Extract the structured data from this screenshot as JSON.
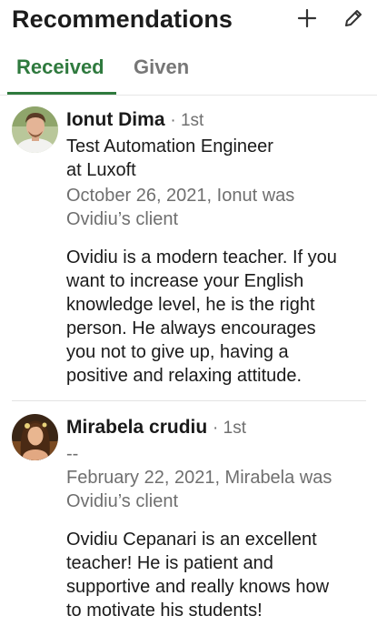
{
  "header": {
    "title": "Recommendations",
    "add_icon": "plus-icon",
    "edit_icon": "pencil-icon"
  },
  "tabs": [
    {
      "label": "Received",
      "active": true
    },
    {
      "label": "Given",
      "active": false
    }
  ],
  "colors": {
    "accent": "#2f7a3e",
    "muted_text": "#6f6f6f",
    "divider": "#e3e3e3"
  },
  "recommendations": [
    {
      "name": "Ionut Dima",
      "degree": "· 1st",
      "headline_line1": "Test Automation Engineer",
      "headline_line2": "at Luxoft",
      "meta_line1": "October 26, 2021, Ionut was",
      "meta_line2": "Ovidiu’s client",
      "text_lines": [
        "Ovidiu is a modern teacher. If you",
        "want to increase your English",
        "knowledge level, he is the right",
        "person. He always encourages",
        "you not to give up, having a",
        "positive and relaxing attitude."
      ]
    },
    {
      "name": "Mirabela crudiu",
      "degree": "· 1st",
      "headline_line1": "--",
      "meta_line1": "February 22, 2021, Mirabela was",
      "meta_line2": "Ovidiu’s client",
      "text_lines": [
        "Ovidiu Cepanari is an excellent",
        "teacher! He is patient and",
        "supportive and really knows how",
        "to motivate his students!"
      ]
    }
  ]
}
